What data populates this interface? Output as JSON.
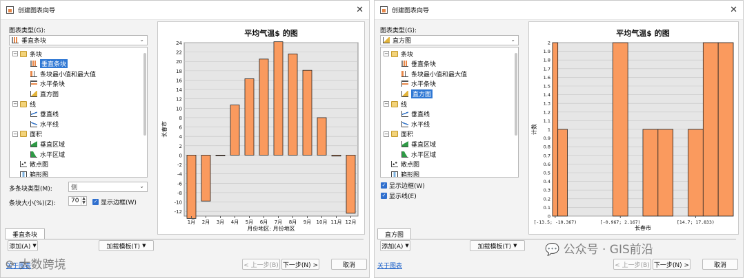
{
  "left": {
    "window_title": "创建图表向导",
    "chart_type_label": "图表类型(G):",
    "chart_type_value": "垂直条块",
    "tree": [
      {
        "label": "条块",
        "icon": "folder-icon",
        "level": 0,
        "folder": true
      },
      {
        "label": "垂直条块",
        "icon": "vertical-bar-icon",
        "level": 1,
        "selected": true
      },
      {
        "label": "条块最小值和最大值",
        "icon": "minmax-bar-icon",
        "level": 1
      },
      {
        "label": "水平条块",
        "icon": "horizontal-bar-icon",
        "level": 1
      },
      {
        "label": "直方图",
        "icon": "histogram-icon",
        "level": 1
      },
      {
        "label": "线",
        "icon": "folder-icon",
        "level": 0,
        "folder": true
      },
      {
        "label": "垂直线",
        "icon": "vertical-line-icon",
        "level": 1
      },
      {
        "label": "水平线",
        "icon": "horizontal-line-icon",
        "level": 1
      },
      {
        "label": "面积",
        "icon": "folder-icon",
        "level": 0,
        "folder": true
      },
      {
        "label": "垂直区域",
        "icon": "vertical-area-icon",
        "level": 1
      },
      {
        "label": "水平区域",
        "icon": "horizontal-area-icon",
        "level": 1
      },
      {
        "label": "散点图",
        "icon": "scatter-icon",
        "level": 0
      },
      {
        "label": "箱形图",
        "icon": "boxplot-icon",
        "level": 0
      }
    ],
    "multibar_label": "多条块类型(M):",
    "multibar_value": "侧",
    "barsize_label": "条块大小(%)(Z):",
    "barsize_value": "70",
    "show_border_label": "显示边框(W)",
    "tab_label": "垂直条块",
    "add_button": "添加(A)",
    "load_template_button": "加载模板(T)",
    "prev_button": "< 上一步(B)",
    "next_button": "下一步(N) >",
    "cancel_button": "取消",
    "about_link": "关于图表"
  },
  "right": {
    "window_title": "创建图表向导",
    "chart_type_label": "图表类型(G):",
    "chart_type_value": "直方图",
    "tree": [
      {
        "label": "条块",
        "icon": "folder-icon",
        "level": 0,
        "folder": true
      },
      {
        "label": "垂直条块",
        "icon": "vertical-bar-icon",
        "level": 1
      },
      {
        "label": "条块最小值和最大值",
        "icon": "minmax-bar-icon",
        "level": 1
      },
      {
        "label": "水平条块",
        "icon": "horizontal-bar-icon",
        "level": 1
      },
      {
        "label": "直方图",
        "icon": "histogram-icon",
        "level": 1,
        "selected": true
      },
      {
        "label": "线",
        "icon": "folder-icon",
        "level": 0,
        "folder": true
      },
      {
        "label": "垂直线",
        "icon": "vertical-line-icon",
        "level": 1
      },
      {
        "label": "水平线",
        "icon": "horizontal-line-icon",
        "level": 1
      },
      {
        "label": "面积",
        "icon": "folder-icon",
        "level": 0,
        "folder": true
      },
      {
        "label": "垂直区域",
        "icon": "vertical-area-icon",
        "level": 1
      },
      {
        "label": "水平区域",
        "icon": "horizontal-area-icon",
        "level": 1
      },
      {
        "label": "散点图",
        "icon": "scatter-icon",
        "level": 0
      },
      {
        "label": "箱形图",
        "icon": "boxplot-icon",
        "level": 0
      }
    ],
    "show_border_label": "显示边框(W)",
    "show_line_label": "显示线(E)",
    "tab_label": "直方图",
    "add_button": "添加(A)",
    "load_template_button": "加载模板(T)",
    "prev_button": "< 上一步(B)",
    "next_button": "下一步(N) >",
    "cancel_button": "取消",
    "about_link": "关于图表"
  },
  "watermarks": {
    "left": "大数跨境",
    "right": "公众号 · GIS前沿"
  },
  "colors": {
    "bar_fill": "#fa9a5e",
    "bar_stroke": "#222222",
    "plot_bg": "#e6e6e6",
    "selection": "#2f78d4"
  },
  "chart_data": [
    {
      "type": "bar",
      "title": "平均气温$ 的图",
      "xlabel": "月份地区: 月份地区",
      "ylabel": "长春市",
      "categories": [
        "1月",
        "2月",
        "3月",
        "4月",
        "5月",
        "6月",
        "7月",
        "8月",
        "9月",
        "10月",
        "11月",
        "12月"
      ],
      "values": [
        -13.5,
        -9.8,
        0,
        10.7,
        16.3,
        20.5,
        24.2,
        21.6,
        18.1,
        8.0,
        -0.2,
        -12.4
      ],
      "ylim": [
        -13,
        24
      ],
      "yticks": [
        -12,
        -10,
        -8,
        -6,
        -4,
        -2,
        0,
        2,
        4,
        6,
        8,
        10,
        12,
        14,
        16,
        18,
        20,
        22,
        24
      ],
      "grid": true
    },
    {
      "type": "bar",
      "title": "平均气温$ 的图",
      "xlabel": "长春市",
      "ylabel": "计数",
      "categories": [
        "[-13.5; -10.367)",
        "[-0.967; 2.167)",
        "[14.7; 17.833)"
      ],
      "bins": [
        {
          "from": -13.5,
          "to": -12.4,
          "count": 2
        },
        {
          "from": -12.4,
          "to": -10.4,
          "count": 1
        },
        {
          "from": -10.4,
          "to": -8.6,
          "count": 0
        },
        {
          "from": -8.6,
          "to": -6.8,
          "count": 0
        },
        {
          "from": -6.8,
          "to": -3.9,
          "count": 0
        },
        {
          "from": -3.9,
          "to": -0.967,
          "count": 0
        },
        {
          "from": -0.967,
          "to": 2.167,
          "count": 2
        },
        {
          "from": 2.167,
          "to": 5.3,
          "count": 0
        },
        {
          "from": 5.3,
          "to": 8.433,
          "count": 1
        },
        {
          "from": 8.433,
          "to": 11.567,
          "count": 1
        },
        {
          "from": 11.567,
          "to": 14.7,
          "count": 0
        },
        {
          "from": 14.7,
          "to": 17.833,
          "count": 1
        },
        {
          "from": 17.833,
          "to": 20.967,
          "count": 2
        },
        {
          "from": 20.967,
          "to": 24.1,
          "count": 2
        }
      ],
      "ylim": [
        0,
        2
      ],
      "yticks": [
        0,
        0.1,
        0.2,
        0.3,
        0.4,
        0.5,
        0.6,
        0.7,
        0.8,
        0.9,
        1,
        1.1,
        1.2,
        1.3,
        1.4,
        1.5,
        1.6,
        1.7,
        1.8,
        1.9,
        2
      ],
      "grid": true
    }
  ]
}
